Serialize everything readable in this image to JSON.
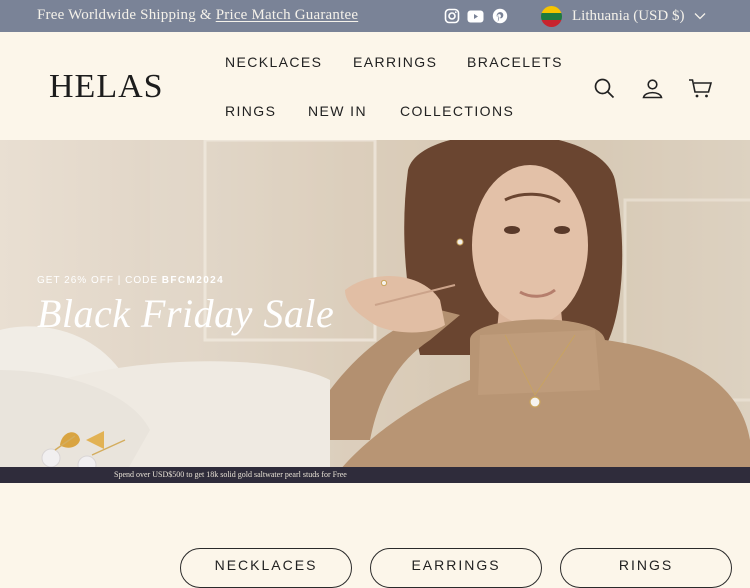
{
  "announcement": {
    "text": "Free Worldwide Shipping & ",
    "link_text": "Price Match Guarantee"
  },
  "social": [
    "instagram-icon",
    "youtube-icon",
    "pinterest-icon"
  ],
  "country_selector": {
    "label": "Lithuania (USD $)",
    "flag": "lithuania-flag"
  },
  "header": {
    "logo": "HELAS",
    "nav": [
      "NECKLACES",
      "EARRINGS",
      "BRACELETS",
      "RINGS",
      "NEW IN",
      "COLLECTIONS"
    ],
    "icons": [
      "search-icon",
      "account-icon",
      "cart-icon"
    ]
  },
  "hero": {
    "kicker": "GET 26% OFF | CODE ",
    "code": "BFCM2024",
    "title": "Black Friday Sale",
    "strip_text": "Spend over USD$500 to get 18k solid gold saltwater pearl studs for Free"
  },
  "categories": [
    "NECKLACES",
    "EARRINGS",
    "RINGS"
  ],
  "colors": {
    "topbar": "#7a8397",
    "background": "#fcf6ea",
    "strip": "#2f2c3b"
  }
}
